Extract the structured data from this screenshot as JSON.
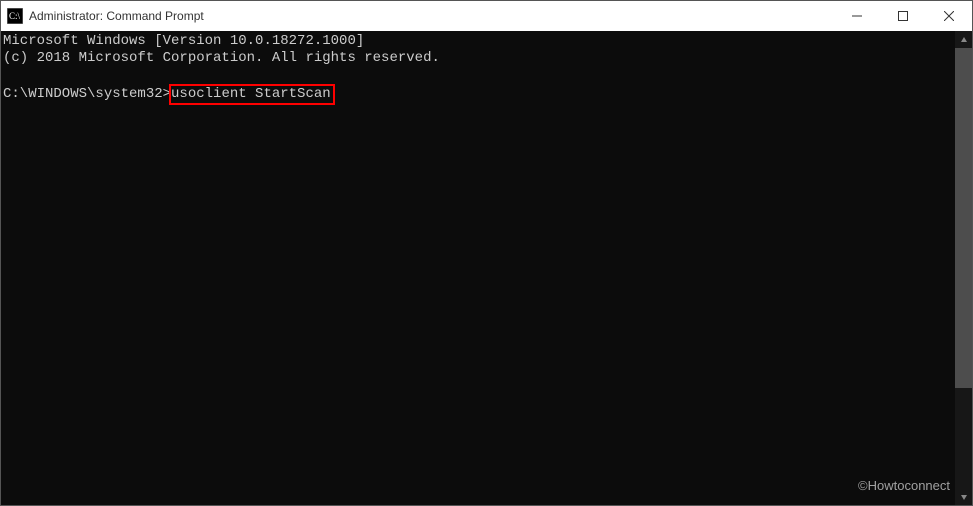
{
  "window": {
    "title": "Administrator: Command Prompt"
  },
  "terminal": {
    "line1": "Microsoft Windows [Version 10.0.18272.1000]",
    "line2": "(c) 2018 Microsoft Corporation. All rights reserved.",
    "promptPath": "C:\\WINDOWS\\system32>",
    "command": "usoclient StartScan"
  },
  "watermark": "©Howtoconnect"
}
